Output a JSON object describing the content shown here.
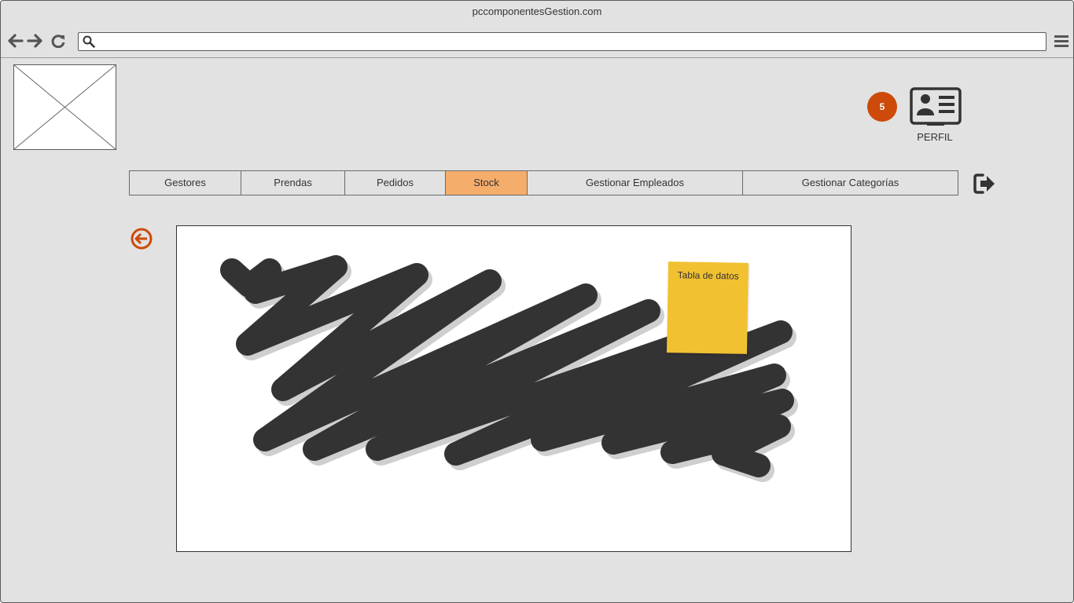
{
  "window": {
    "title": "pccomponentesGestion.com"
  },
  "toolbar": {
    "back_icon": "arrow-left-icon",
    "forward_icon": "arrow-right-icon",
    "reload_icon": "reload-icon",
    "search_icon": "search-icon",
    "address_value": "",
    "menu_icon": "hamburger-icon"
  },
  "header": {
    "logo": "image-placeholder",
    "notification_count": "5",
    "profile_label": "PERFIL",
    "profile_icon": "id-card-icon"
  },
  "nav": {
    "tabs": [
      {
        "label": "Gestores",
        "active": false
      },
      {
        "label": "Prendas",
        "active": false
      },
      {
        "label": "Pedidos",
        "active": false
      },
      {
        "label": "Stock",
        "active": true
      },
      {
        "label": "Gestionar Empleados",
        "active": false
      },
      {
        "label": "Gestionar Categorías",
        "active": false
      }
    ],
    "logout_icon": "logout-icon"
  },
  "main": {
    "back_icon": "circle-arrow-left-icon",
    "sticky_note": "Tabla de datos"
  },
  "colors": {
    "background": "#e1e2e1",
    "active_tab": "#f5ad6b",
    "badge": "#cd4a0a",
    "sticky": "#f2c131",
    "scribble": "#333333"
  }
}
